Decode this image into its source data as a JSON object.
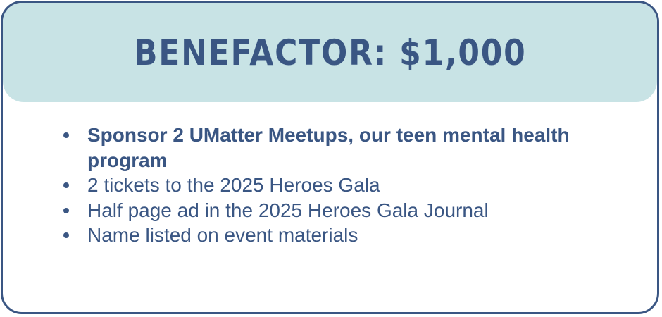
{
  "header": {
    "title": "BENEFACTOR: $1,000"
  },
  "benefits": [
    "Sponsor 2 UMatter Meetups, our teen mental health program",
    "2 tickets to the 2025 Heroes Gala",
    "Half page ad in the 2025 Heroes Gala Journal",
    "Name listed on event materials"
  ],
  "colors": {
    "border": "#3a5683",
    "header_background": "#c8e3e5",
    "text": "#3a5683"
  }
}
